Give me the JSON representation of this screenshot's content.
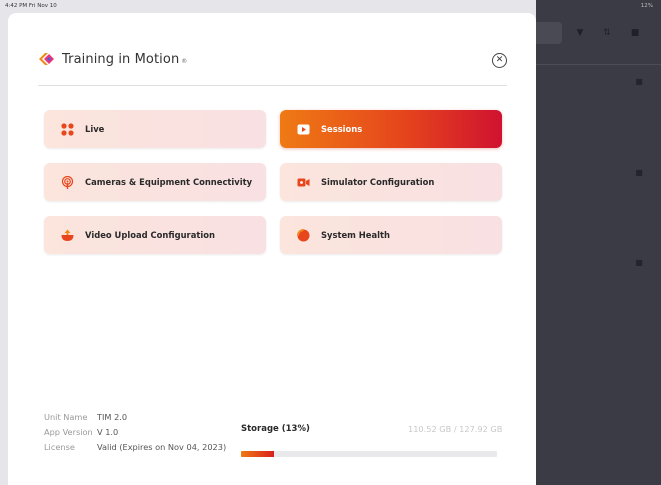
{
  "status_bar": {
    "time": "4:42 PM  Fri Nov 10",
    "battery": "12%"
  },
  "header": {
    "brand_name": "Training in Motion",
    "brand_mark": "®"
  },
  "menu": [
    {
      "label": "Live",
      "icon": "grid-dots-icon",
      "active": false
    },
    {
      "label": "Sessions",
      "icon": "play-icon",
      "active": true
    },
    {
      "label": "Cameras & Equipment Connectivity",
      "icon": "signal-icon",
      "active": false
    },
    {
      "label": "Simulator Configuration",
      "icon": "video-camera-icon",
      "active": false
    },
    {
      "label": "Video Upload Configuration",
      "icon": "upload-icon",
      "active": false
    },
    {
      "label": "System Health",
      "icon": "health-icon",
      "active": false
    }
  ],
  "footer": {
    "unit_name_label": "Unit Name",
    "unit_name_value": "TIM 2.0",
    "app_version_label": "App Version",
    "app_version_value": "V 1.0",
    "license_label": "License",
    "license_value": "Valid (Expires on Nov 04, 2023)",
    "storage_label": "Storage (13%)",
    "storage_value": "110.52 GB / 127.92 GB",
    "storage_fraction": 0.13
  },
  "colors": {
    "accent_start": "#ef7a14",
    "accent_end": "#d01230",
    "tile_bg": "#fbe5dc"
  }
}
